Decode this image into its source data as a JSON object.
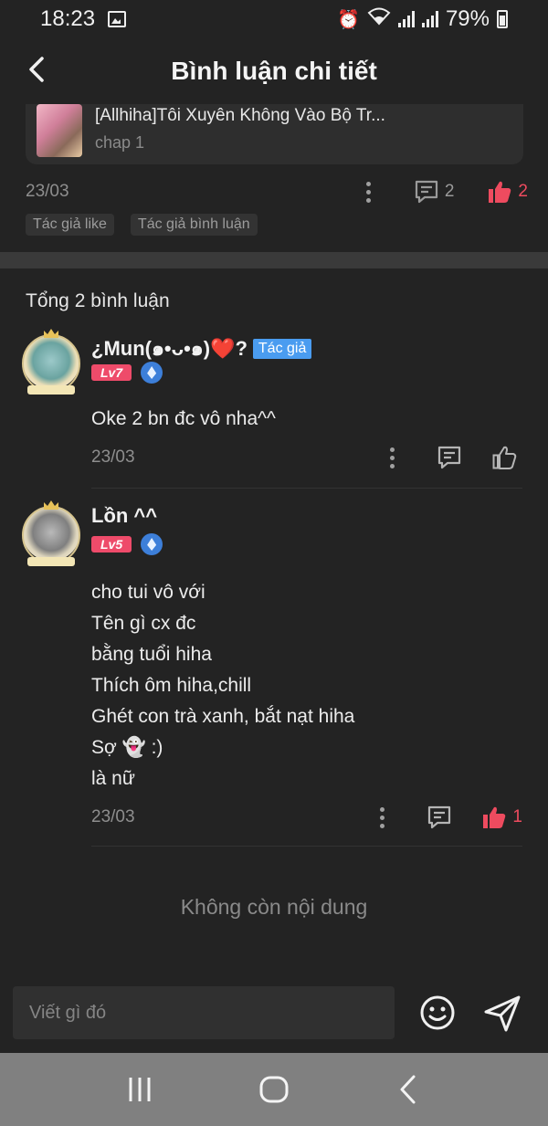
{
  "status_bar": {
    "time": "18:23",
    "battery": "79%",
    "icons": [
      "image-icon",
      "alarm-icon",
      "wifi-icon",
      "signal-icon",
      "signal-icon",
      "battery-icon"
    ]
  },
  "header": {
    "title": "Bình luận chi tiết"
  },
  "story": {
    "title": "[Allhiha]Tôi Xuyên Không Vào Bộ Tr...",
    "chapter": "chap 1"
  },
  "post": {
    "date": "23/03",
    "comment_count": "2",
    "like_count": "2",
    "tags": [
      "Tác giả like",
      "Tác giả bình luận"
    ]
  },
  "comments_header": {
    "total": "Tổng 2 bình luận"
  },
  "comments": [
    {
      "name": "¿Mun(๑•ᴗ•๑)❤️?",
      "author_badge": "Tác giả",
      "level": "Lv7",
      "lines": [
        "Oke 2 bn đc vô nha^^"
      ],
      "date": "23/03",
      "likes": ""
    },
    {
      "name": "Lồn ^^",
      "level": "Lv5",
      "lines": [
        "cho tui vô với",
        "Tên gì cx đc",
        "bằng tuổi hiha",
        "Thích ôm hiha,chill",
        "Ghét con trà xanh, bắt nạt hiha",
        "Sợ 👻 :)",
        "là nữ"
      ],
      "date": "23/03",
      "likes": "1"
    }
  ],
  "end_message": "Không còn nội dung",
  "composer": {
    "placeholder": "Viết gì đó"
  },
  "colors": {
    "background": "#232323",
    "accent_red": "#ee4b5f",
    "author_badge": "#4a9cf0",
    "level_badge": "#ee4b6a"
  }
}
